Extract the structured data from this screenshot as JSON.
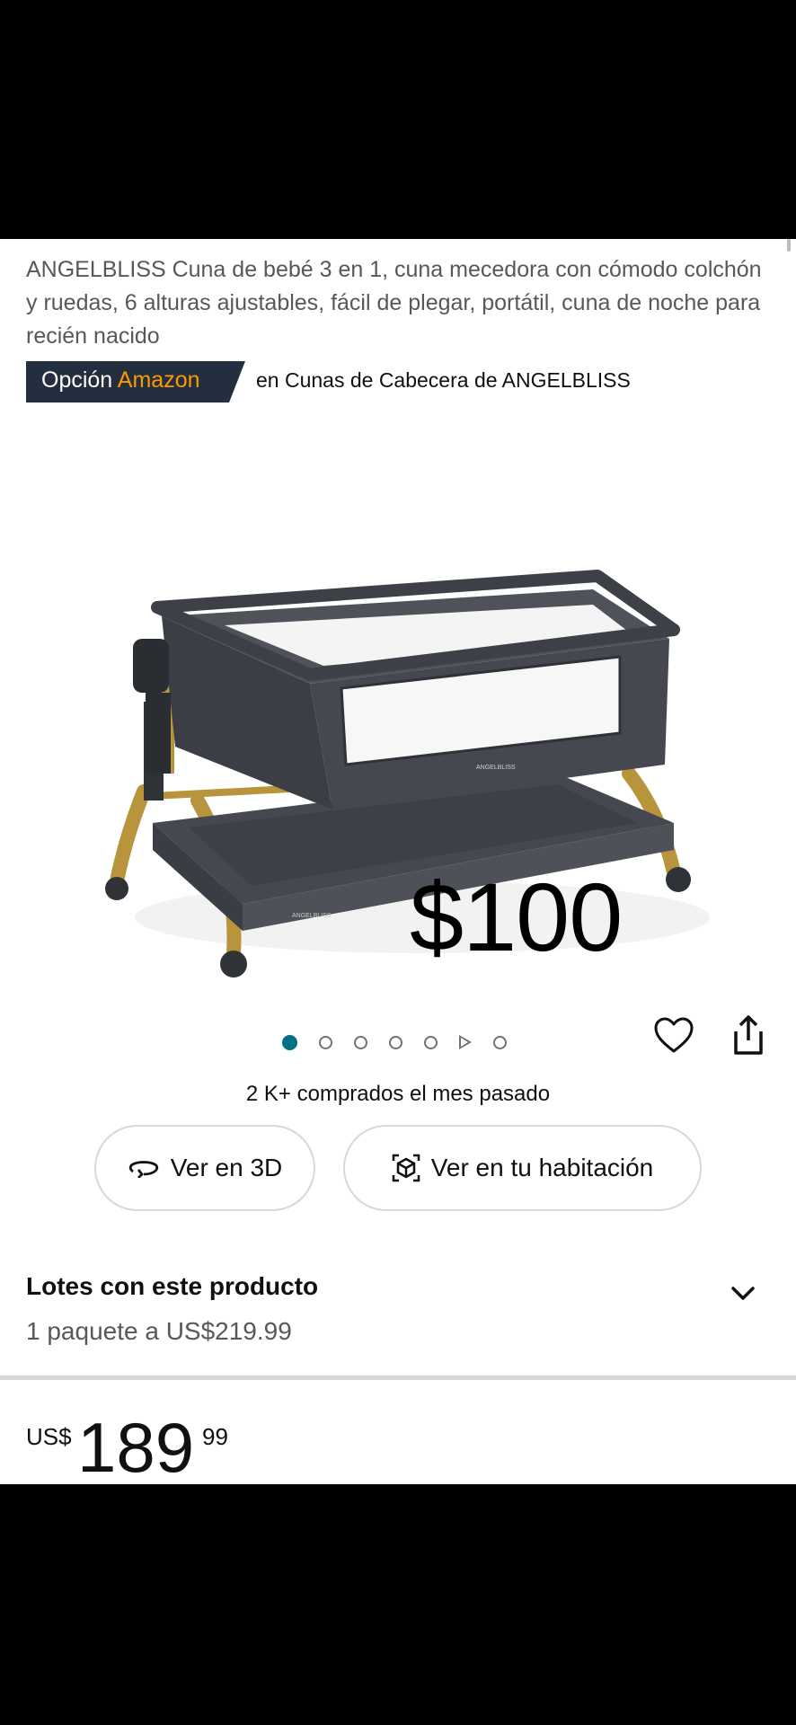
{
  "product": {
    "title": "ANGELBLISS Cuna de bebé 3 en 1, cuna mecedora con cómodo colchón y ruedas, 6 alturas ajustables, fácil de plegar, portátil, cuna de noche para recién nacido",
    "badge": {
      "prefix": "Opción",
      "accent": "Amazon",
      "category": "en Cunas de Cabecera de ANGELBLISS"
    },
    "image_price_overlay": "$100",
    "image_brand": "ANGELBLISS",
    "gallery": {
      "count": 7,
      "active_index": 0
    },
    "social_proof": "2 K+ comprados el mes pasado"
  },
  "actions": {
    "view_3d": "Ver en 3D",
    "view_room": "Ver en tu habitación"
  },
  "bundles": {
    "title": "Lotes con este producto",
    "subtitle": "1 paquete a US$219.99"
  },
  "price": {
    "symbol": "US$",
    "whole": "189",
    "fraction": "99"
  },
  "colors": {
    "accent": "#ff9900",
    "badge_bg": "#232f3e",
    "active_dot": "#007185"
  }
}
